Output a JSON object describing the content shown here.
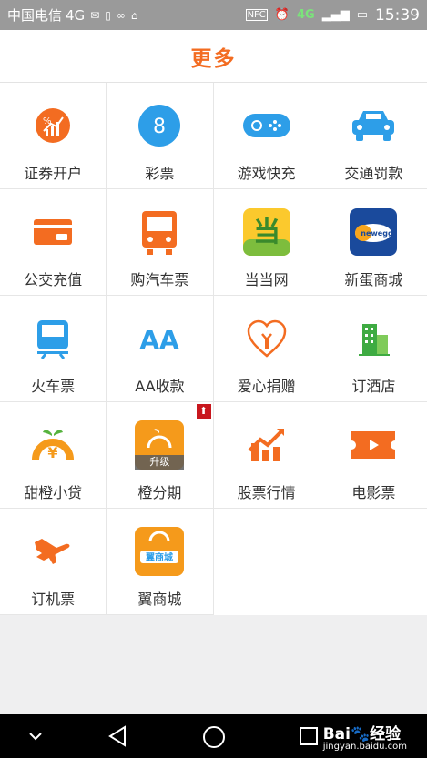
{
  "statusbar": {
    "carrier": "中国电信",
    "network": "4G",
    "time": "15:39",
    "nfc": "NFC",
    "net_right": "4G"
  },
  "header": {
    "title": "更多"
  },
  "grid": {
    "items": [
      {
        "label": "证券开户",
        "icon": "stock-account-icon"
      },
      {
        "label": "彩票",
        "icon": "lottery-icon",
        "icon_text": "8"
      },
      {
        "label": "游戏快充",
        "icon": "gamepad-icon"
      },
      {
        "label": "交通罚款",
        "icon": "car-icon"
      },
      {
        "label": "公交充值",
        "icon": "bus-card-icon"
      },
      {
        "label": "购汽车票",
        "icon": "bus-icon"
      },
      {
        "label": "当当网",
        "icon": "dangdang-logo-icon",
        "icon_text": "当"
      },
      {
        "label": "新蛋商城",
        "icon": "newegg-logo-icon",
        "icon_text": "newegg"
      },
      {
        "label": "火车票",
        "icon": "train-icon"
      },
      {
        "label": "AA收款",
        "icon": "aa-collection-icon",
        "icon_text": "AA"
      },
      {
        "label": "爱心捐赠",
        "icon": "heart-donation-icon"
      },
      {
        "label": "订酒店",
        "icon": "hotel-icon"
      },
      {
        "label": "甜橙小贷",
        "icon": "orange-loan-icon",
        "icon_text": "¥"
      },
      {
        "label": "橙分期",
        "icon": "orange-installment-icon",
        "upgrade": "升级",
        "badge": "⬆"
      },
      {
        "label": "股票行情",
        "icon": "stock-chart-icon"
      },
      {
        "label": "电影票",
        "icon": "movie-ticket-icon"
      },
      {
        "label": "订机票",
        "icon": "airplane-icon"
      },
      {
        "label": "翼商城",
        "icon": "shopping-bag-icon",
        "icon_text": "翼商城"
      }
    ]
  },
  "watermark": {
    "brand": "Bai",
    "brand2": "经验",
    "url": "jingyan.baidu.com"
  },
  "colors": {
    "accent": "#f36c21",
    "blue": "#2d9ee8",
    "orange": "#f36c21"
  }
}
